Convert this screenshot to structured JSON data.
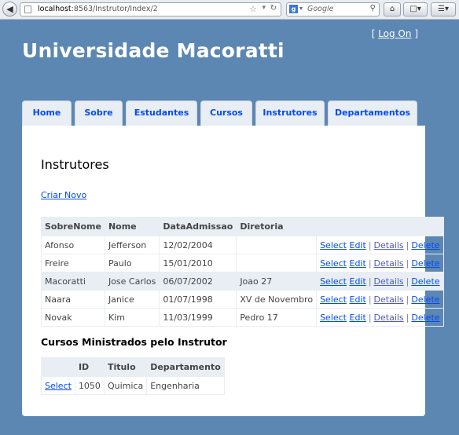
{
  "browser": {
    "url_host": "localhost",
    "url_path": ":8563/Instrutor/Index/2",
    "search_placeholder": "Google"
  },
  "header": {
    "login_open": "[ ",
    "login_link": "Log On",
    "login_close": " ]",
    "title": "Universidade Macoratti"
  },
  "menu": [
    "Home",
    "Sobre",
    "Estudantes",
    "Cursos",
    "Instrutores",
    "Departamentos"
  ],
  "main": {
    "heading": "Instrutores",
    "create_link": "Criar Novo"
  },
  "instructors": {
    "columns": [
      "SobreNome",
      "Nome",
      "DataAdmissao",
      "Diretoria",
      ""
    ],
    "rows": [
      {
        "last": "Afonso",
        "first": "Jefferson",
        "date": "12/02/2004",
        "office": "",
        "selected": false
      },
      {
        "last": "Freire",
        "first": "Paulo",
        "date": "15/01/2010",
        "office": "",
        "selected": false
      },
      {
        "last": "Macoratti",
        "first": "Jose Carlos",
        "date": "06/07/2002",
        "office": "Joao 27",
        "selected": true
      },
      {
        "last": "Naara",
        "first": "Janice",
        "date": "01/07/1998",
        "office": "XV de Novembro",
        "selected": false
      },
      {
        "last": "Novak",
        "first": "Kim",
        "date": "11/03/1999",
        "office": "Pedro 17",
        "selected": false
      }
    ],
    "actions": {
      "select": "Select",
      "edit": "Edit",
      "details": "Details",
      "delete": "Delete",
      "separator": "|"
    }
  },
  "courses": {
    "heading": "Cursos Ministrados pelo Instrutor",
    "columns": [
      "",
      "ID",
      "Titulo",
      "Departamento"
    ],
    "rows": [
      {
        "action": "Select",
        "id": "1050",
        "title": "Quimica",
        "department": "Engenharia"
      }
    ]
  }
}
